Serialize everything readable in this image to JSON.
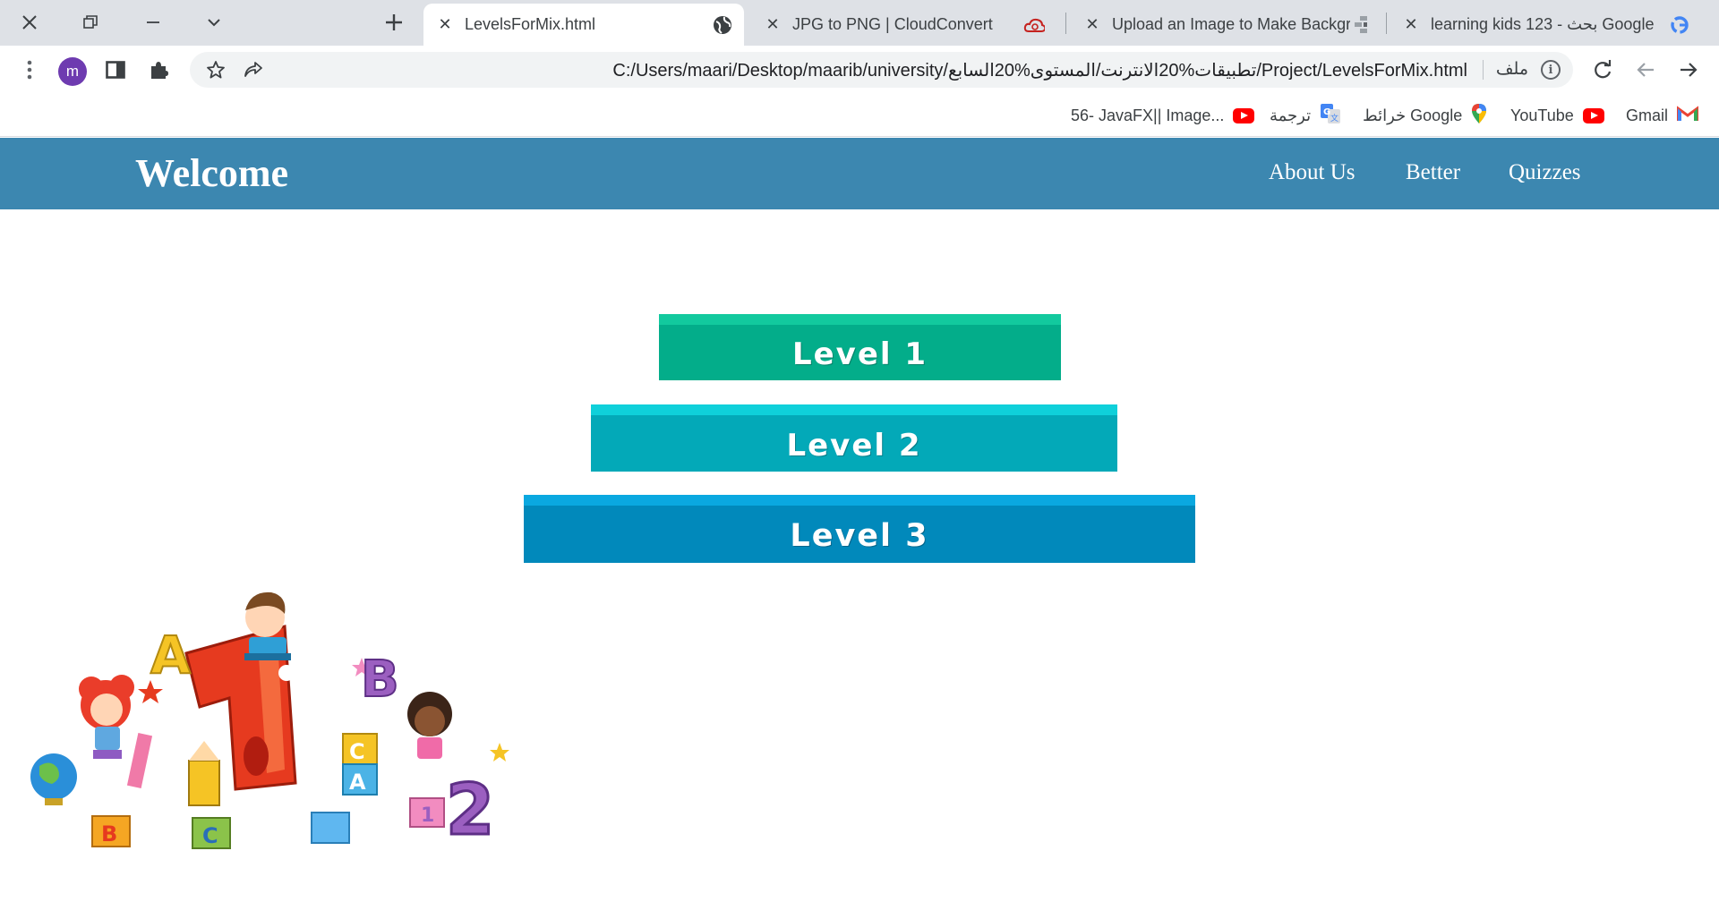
{
  "browser": {
    "tabs": [
      {
        "title": "LevelsForMix.html",
        "active": true
      },
      {
        "title": "JPG to PNG | CloudConvert",
        "active": false
      },
      {
        "title": "Upload an Image to Make Backgr",
        "active": false
      },
      {
        "title": "learning kids 123 - بحث Google",
        "active": false
      }
    ],
    "profile_initial": "m",
    "url": "C:/Users/maari/Desktop/maarib/university/تطبيقات%20الانترنت/المستوى%20السابع/Project/LevelsForMix.html",
    "url_label": "ملف",
    "bookmarks": [
      {
        "label": "Gmail",
        "icon": "gmail-icon"
      },
      {
        "label": "YouTube",
        "icon": "youtube-icon"
      },
      {
        "label": "خرائط Google",
        "icon": "maps-icon"
      },
      {
        "label": "ترجمة",
        "icon": "translate-icon"
      },
      {
        "label": "56- JavaFX|| Image...",
        "icon": "youtube-icon"
      }
    ]
  },
  "site": {
    "title": "Welcome",
    "nav": [
      "About Us",
      "Better",
      "Quizzes"
    ],
    "levels": [
      {
        "label": "Level 1",
        "color": "#03ad8a",
        "cap_color": "#12c99e"
      },
      {
        "label": "Level 2",
        "color": "#03a9b8",
        "cap_color": "#0fd0da"
      },
      {
        "label": "Level 3",
        "color": "#0189bb",
        "cap_color": "#0aa8e0"
      }
    ],
    "illustration_letters": [
      "A",
      "B",
      "C",
      "A",
      "B",
      "C",
      "1",
      "2"
    ]
  }
}
